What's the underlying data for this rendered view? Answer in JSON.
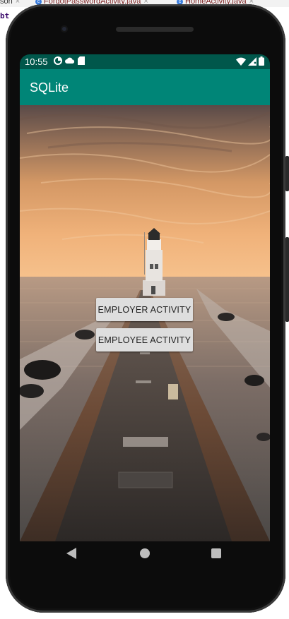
{
  "ide": {
    "tabs": [
      {
        "label": "son",
        "close": "×"
      },
      {
        "label": "ForgotPasswordActivity.java",
        "close": "×"
      },
      {
        "label": "HomeActivity.java",
        "close": "×"
      }
    ],
    "code_snippet": "bt"
  },
  "status_bar": {
    "time": "10:55",
    "left_icons": [
      "data-saver-icon",
      "cloud-icon",
      "sd-card-icon"
    ],
    "right_icons": [
      "wifi-icon",
      "signal-icon",
      "battery-icon"
    ]
  },
  "app_bar": {
    "title": "SQLite",
    "color": "#008577",
    "status_color": "#00574b"
  },
  "buttons": {
    "employer_label": "EMPLOYER ACTIVITY",
    "employee_label": "EMPLOYEE ACTIVITY"
  },
  "background_image": "lighthouse-pier-sunset",
  "nav_bar": {
    "icons": [
      "back-icon",
      "home-icon",
      "recents-icon"
    ]
  }
}
